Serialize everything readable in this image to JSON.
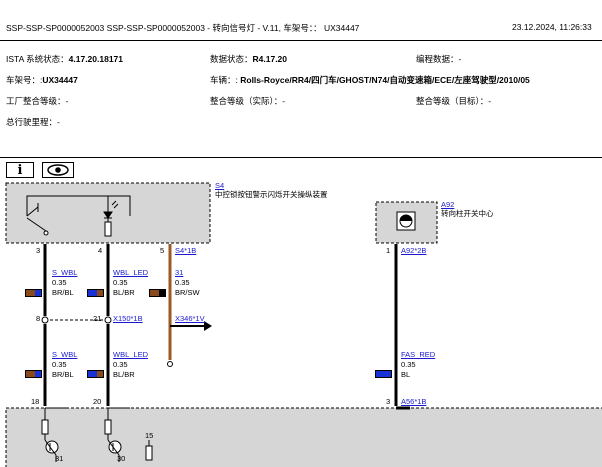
{
  "header": {
    "title": "SSP-SSP-SP0000052003  SSP-SSP-SP0000052003 - 转向信号灯 - V.11, 车架号：： UX34447",
    "datetime": "23.12.2024,  11:26:33",
    "ista_label": "ISTA 系统状态：",
    "ista_value": "4.17.20.18171",
    "data_label": "数据状态：",
    "data_value": "R4.17.20",
    "prog_label": "编程数据：-",
    "vin_label": "车架号：:",
    "vin_value": "UX34447",
    "vehicle_label": "车辆：: ",
    "vehicle_value": "Rolls-Royce/RR4/四门车/GHOST/N74/自动变速箱/ECE/左座驾驶型/2010/05",
    "factory_level": "工厂整合等级：-",
    "level_actual": "整合等级（实际）：-",
    "level_target": "整合等级（目标）：-",
    "mileage": "总行驶里程：-"
  },
  "toolbar": {
    "info_icon": "info-icon",
    "eye_icon": "eye-icon"
  },
  "components": {
    "s4_id": "S4",
    "s4_desc": "中控锁按钮警示闪烁开关操纵装置",
    "a92_id": "A92",
    "a92_desc": "转向柱开关中心"
  },
  "pins": {
    "s4_p3": "3",
    "s4_p4": "4",
    "s4_p5": "5",
    "s4_conn": "S4*1B",
    "a92_p1": "1",
    "a92_conn": "A92*2B",
    "x150_p8": "8",
    "x150_p21": "21",
    "x150_conn": "X150*1B",
    "x346_conn": "X346*1V",
    "bottom_p18": "18",
    "bottom_p20": "20",
    "a56_p3": "3",
    "a56_conn": "A56*1B",
    "tr_31": "31",
    "tr_30": "30",
    "tr_15": "15"
  },
  "wires": {
    "w1_name": "S_WBL",
    "w1_size": "0.35",
    "w1_color": "BR/BL",
    "w2_name": "WBL_LED",
    "w2_size": "0.35",
    "w2_color": "BL/BR",
    "w3_name": "31",
    "w3_size": "0.35",
    "w3_color": "BR/SW",
    "w4_name": "S_WBL",
    "w4_size": "0.35",
    "w4_color": "BR/BL",
    "w5_name": "WBL_LED",
    "w5_size": "0.35",
    "w5_color": "BL/BR",
    "w6_name": "FAS_RED",
    "w6_size": "0.35",
    "w6_color": "BL"
  },
  "colors": {
    "brown": "#8b4a1c",
    "blue": "#1733d6",
    "black": "#000000",
    "wire_brown": "#9a5a25",
    "box_fill": "#d6d6d6",
    "link": "#1a1ad0"
  }
}
